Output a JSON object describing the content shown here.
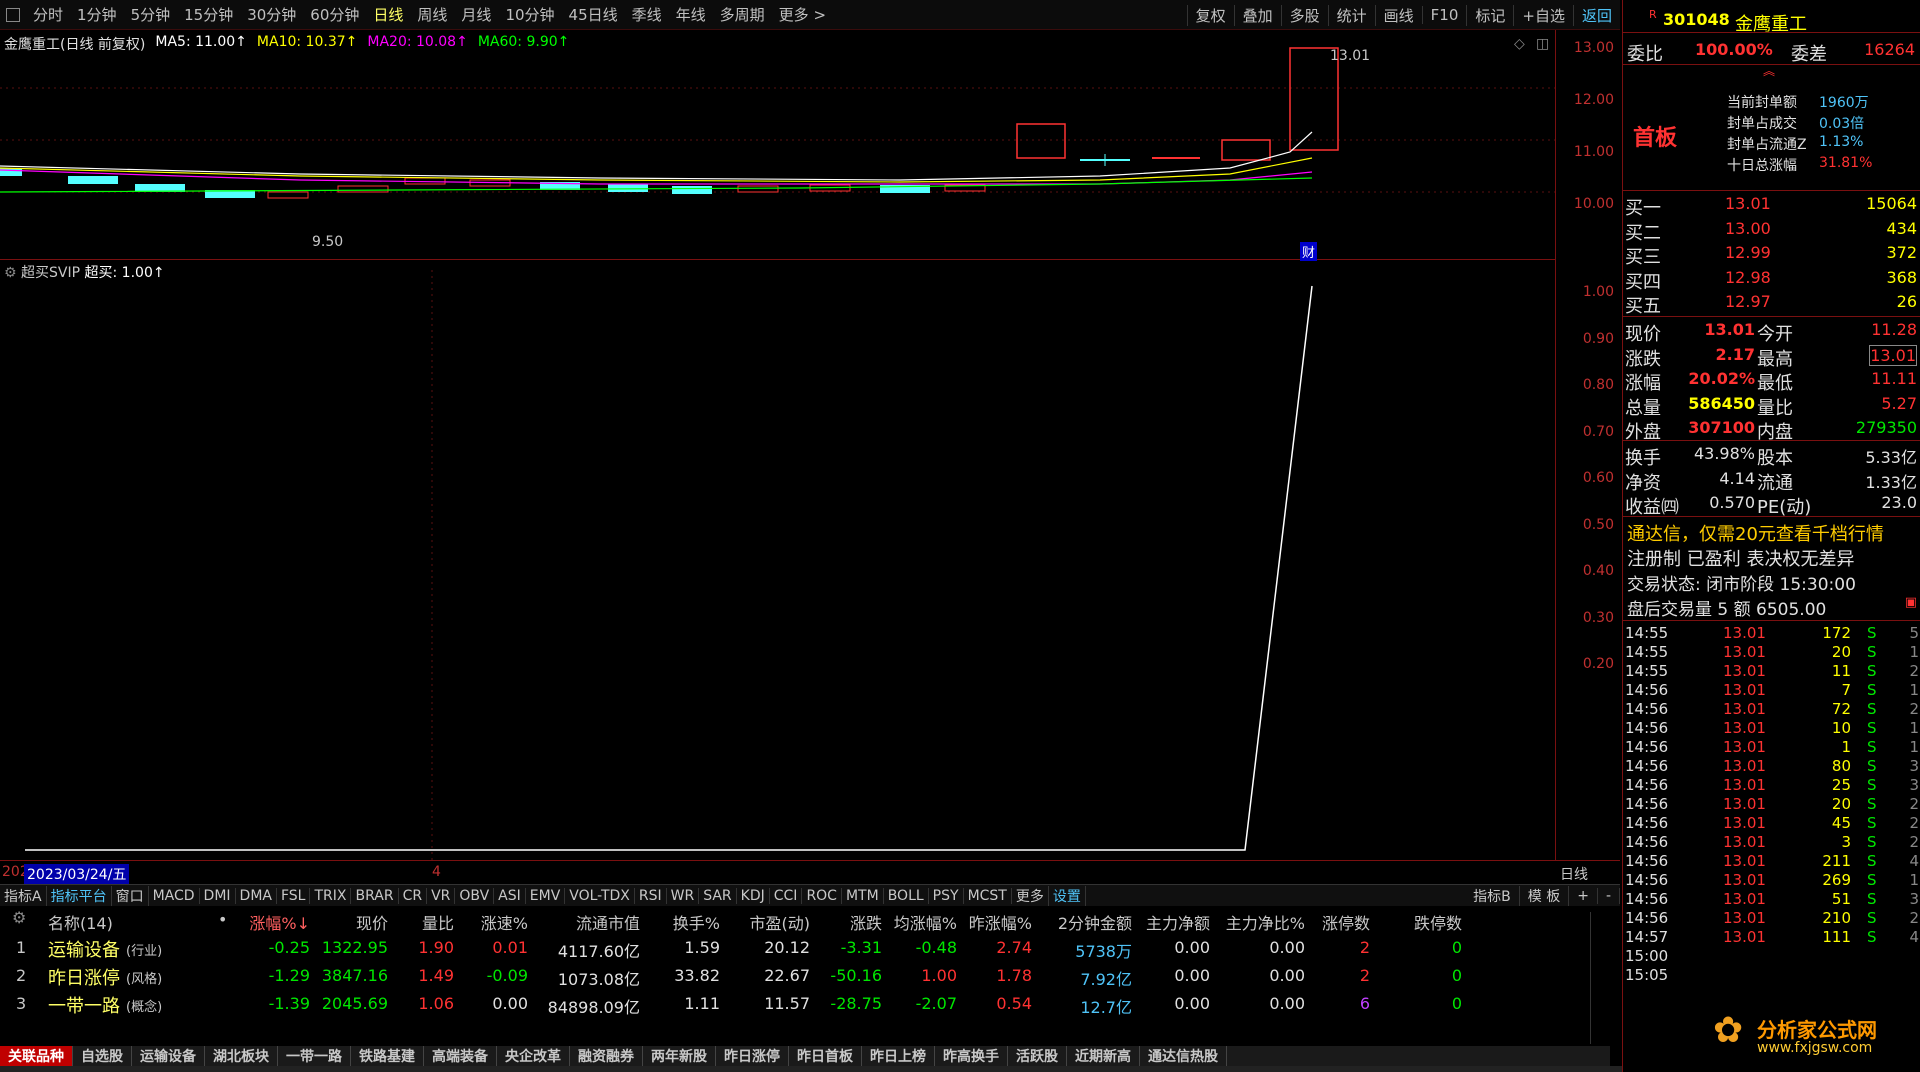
{
  "topbar": {
    "periods": [
      "分时",
      "1分钟",
      "5分钟",
      "15分钟",
      "30分钟",
      "60分钟",
      "日线",
      "周线",
      "月线",
      "10分钟",
      "45日线",
      "季线",
      "年线",
      "多周期",
      "更多 >"
    ],
    "active": "日线",
    "tools": [
      "复权",
      "叠加",
      "多股",
      "统计",
      "画线",
      "F10",
      "标记",
      "+自选",
      "返回"
    ]
  },
  "kheader": {
    "name": "金鹰重工(日线 前复权)",
    "ma5": "MA5: 11.00↑",
    "ma10": "MA10: 10.37↑",
    "ma20": "MA20: 10.08↑",
    "ma60": "MA60: 9.90↑"
  },
  "kchart": {
    "high_label": "13.01",
    "low_label": "9.50",
    "cai_label": "财",
    "yticks": [
      "13.00",
      "12.00",
      "11.00",
      "10.00"
    ]
  },
  "subheader": {
    "name": "超买SVIP",
    "value": "超买: 1.00↑"
  },
  "subchart": {
    "yticks": [
      "1.00",
      "0.90",
      "0.80",
      "0.70",
      "0.60",
      "0.50",
      "0.40",
      "0.30",
      "0.20"
    ]
  },
  "datebar": {
    "prefix": "202",
    "date": "2023/03/24/五",
    "mark4": "4",
    "right": "日线"
  },
  "indtabs": {
    "items": [
      "指标A",
      "指标平台",
      "窗口",
      "MACD",
      "DMI",
      "DMA",
      "FSL",
      "TRIX",
      "BRAR",
      "CR",
      "VR",
      "OBV",
      "ASI",
      "EMV",
      "VOL-TDX",
      "RSI",
      "WR",
      "SAR",
      "KDJ",
      "CCI",
      "ROC",
      "MTM",
      "BOLL",
      "PSY",
      "MCST",
      "更多",
      "设置"
    ],
    "right": [
      "指标B",
      "模 板",
      "+",
      "-"
    ]
  },
  "table": {
    "headers": [
      "名称(14)",
      "涨幅%↓",
      "现价",
      "量比",
      "涨速%",
      "流通市值",
      "换手%",
      "市盈(动)",
      "涨跌",
      "均涨幅%",
      "昨涨幅%",
      "2分钟金额",
      "主力净额",
      "主力净比%",
      "涨停数",
      "跌停数"
    ],
    "rows": [
      {
        "n": "1",
        "name": "运输设备",
        "tag": "(行业)",
        "chg": "-0.25",
        "price": "1322.95",
        "vr": "1.90",
        "spd": "0.01",
        "mcap": "4117.60亿",
        "turn": "1.59",
        "pe": "20.12",
        "diff": "-3.31",
        "avg": "-0.48",
        "yday": "2.74",
        "amt2": "5738万",
        "net": "0.00",
        "netp": "0.00",
        "up": "2",
        "dn": "0"
      },
      {
        "n": "2",
        "name": "昨日涨停",
        "tag": "(风格)",
        "chg": "-1.29",
        "price": "3847.16",
        "vr": "1.49",
        "spd": "-0.09",
        "mcap": "1073.08亿",
        "turn": "33.82",
        "pe": "22.67",
        "diff": "-50.16",
        "avg": "1.00",
        "yday": "1.78",
        "amt2": "7.92亿",
        "net": "0.00",
        "netp": "0.00",
        "up": "2",
        "dn": "0"
      },
      {
        "n": "3",
        "name": "一带一路",
        "tag": "(概念)",
        "chg": "-1.39",
        "price": "2045.69",
        "vr": "1.06",
        "spd": "0.00",
        "mcap": "84898.09亿",
        "turn": "1.11",
        "pe": "11.57",
        "diff": "-28.75",
        "avg": "-2.07",
        "yday": "0.54",
        "amt2": "12.7亿",
        "net": "0.00",
        "netp": "0.00",
        "up": "6",
        "dn": "0"
      }
    ]
  },
  "sectabs": [
    "关联品种",
    "自选股",
    "运输设备",
    "湖北板块",
    "一带一路",
    "铁路基建",
    "高端装备",
    "央企改革",
    "融资融券",
    "两年新股",
    "昨日涨停",
    "昨日首板",
    "昨日上榜",
    "昨高换手",
    "活跃股",
    "近期新高",
    "通达信热股"
  ],
  "rpanel": {
    "code": "301048",
    "name": "金鹰重工",
    "wb_label": "委比",
    "wb_value": "100.00%",
    "wc_label": "委差",
    "wc_value": "16264",
    "shouban": "首板",
    "seal_lines": [
      {
        "label": "当前封单额",
        "value": "1960万"
      },
      {
        "label": "封单占成交",
        "value": "0.03倍"
      },
      {
        "label": "封单占流通Z",
        "value": "1.13%"
      },
      {
        "label": "十日总涨幅",
        "value": "31.81%"
      }
    ],
    "bids": [
      {
        "label": "买一",
        "price": "13.01",
        "vol": "15064"
      },
      {
        "label": "买二",
        "price": "13.00",
        "vol": "434"
      },
      {
        "label": "买三",
        "price": "12.99",
        "vol": "372"
      },
      {
        "label": "买四",
        "price": "12.98",
        "vol": "368"
      },
      {
        "label": "买五",
        "price": "12.97",
        "vol": "26"
      }
    ],
    "quote": [
      {
        "l1": "现价",
        "v1": "13.01",
        "l2": "今开",
        "v2": "11.28"
      },
      {
        "l1": "涨跌",
        "v1": "2.17",
        "l2": "最高",
        "v2": "13.01"
      },
      {
        "l1": "涨幅",
        "v1": "20.02%",
        "l2": "最低",
        "v2": "11.11"
      },
      {
        "l1": "总量",
        "v1": "586450",
        "l2": "量比",
        "v2": "5.27"
      },
      {
        "l1": "外盘",
        "v1": "307100",
        "l2": "内盘",
        "v2": "279350"
      }
    ],
    "fund": [
      {
        "l1": "换手",
        "v1": "43.98%",
        "l2": "股本",
        "v2": "5.33亿"
      },
      {
        "l1": "净资",
        "v1": "4.14",
        "l2": "流通",
        "v2": "1.33亿"
      },
      {
        "l1": "收益㈣",
        "v1": "0.570",
        "l2": "PE(动)",
        "v2": "23.0"
      }
    ],
    "ad": "通达信，仅需20元查看千档行情",
    "reg": "注册制 已盈利 表决权无差异",
    "status": "交易状态: 闭市阶段 15:30:00",
    "after": "盘后交易量 5 额 6505.00",
    "ticks": [
      {
        "t": "14:55",
        "p": "13.01",
        "v": "172",
        "s": "S",
        "x": "5"
      },
      {
        "t": "14:55",
        "p": "13.01",
        "v": "20",
        "s": "S",
        "x": "1"
      },
      {
        "t": "14:55",
        "p": "13.01",
        "v": "11",
        "s": "S",
        "x": "2"
      },
      {
        "t": "14:56",
        "p": "13.01",
        "v": "7",
        "s": "S",
        "x": "1"
      },
      {
        "t": "14:56",
        "p": "13.01",
        "v": "72",
        "s": "S",
        "x": "2"
      },
      {
        "t": "14:56",
        "p": "13.01",
        "v": "10",
        "s": "S",
        "x": "1"
      },
      {
        "t": "14:56",
        "p": "13.01",
        "v": "1",
        "s": "S",
        "x": "1"
      },
      {
        "t": "14:56",
        "p": "13.01",
        "v": "80",
        "s": "S",
        "x": "3"
      },
      {
        "t": "14:56",
        "p": "13.01",
        "v": "25",
        "s": "S",
        "x": "3"
      },
      {
        "t": "14:56",
        "p": "13.01",
        "v": "20",
        "s": "S",
        "x": "2"
      },
      {
        "t": "14:56",
        "p": "13.01",
        "v": "45",
        "s": "S",
        "x": "2"
      },
      {
        "t": "14:56",
        "p": "13.01",
        "v": "3",
        "s": "S",
        "x": "2"
      },
      {
        "t": "14:56",
        "p": "13.01",
        "v": "211",
        "s": "S",
        "x": "4"
      },
      {
        "t": "14:56",
        "p": "13.01",
        "v": "269",
        "s": "S",
        "x": "1"
      },
      {
        "t": "14:56",
        "p": "13.01",
        "v": "51",
        "s": "S",
        "x": "3"
      },
      {
        "t": "14:56",
        "p": "13.01",
        "v": "210",
        "s": "S",
        "x": "2"
      },
      {
        "t": "14:57",
        "p": "13.01",
        "v": "111",
        "s": "S",
        "x": "4"
      },
      {
        "t": "15:00",
        "p": "",
        "v": "",
        "s": "",
        "x": ""
      },
      {
        "t": "15:05",
        "p": "",
        "v": "",
        "s": "",
        "x": ""
      }
    ],
    "watermark": "分析家公式网",
    "watermark_url": "www.fxjgsw.com"
  }
}
